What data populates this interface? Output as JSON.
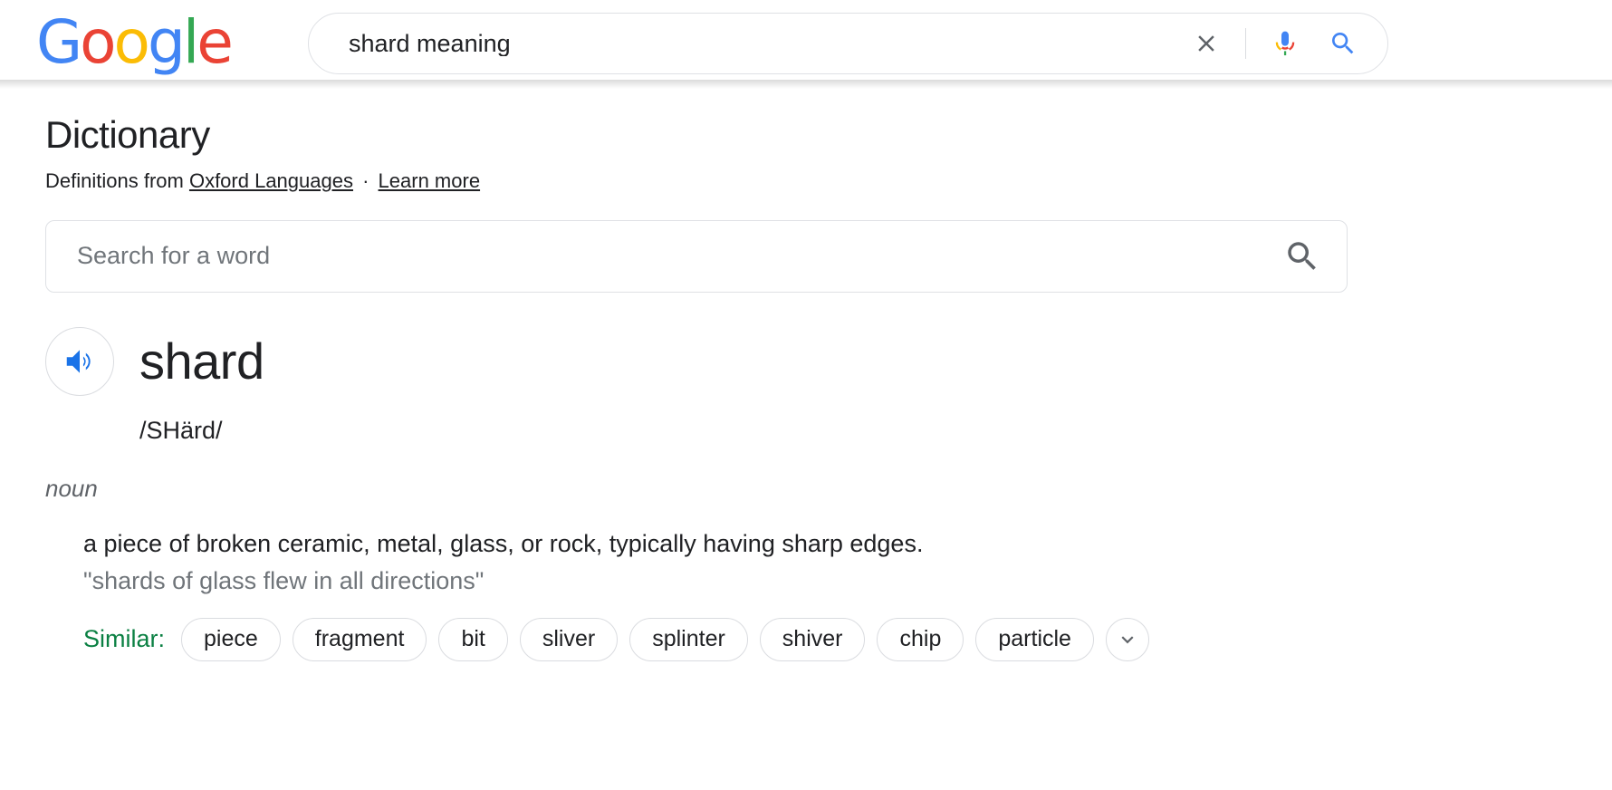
{
  "header": {
    "logo": {
      "letters": [
        {
          "char": "G",
          "color": "#4285F4"
        },
        {
          "char": "o",
          "color": "#EA4335"
        },
        {
          "char": "o",
          "color": "#FBBC05"
        },
        {
          "char": "g",
          "color": "#4285F4"
        },
        {
          "char": "l",
          "color": "#34A853"
        },
        {
          "char": "e",
          "color": "#EA4335"
        }
      ],
      "name": "Google"
    },
    "search": {
      "value": "shard meaning",
      "clear_icon": "close-icon",
      "mic_icon": "microphone-icon",
      "search_icon": "search-icon"
    }
  },
  "main": {
    "title": "Dictionary",
    "attribution": {
      "prefix": "Definitions from ",
      "source_link": "Oxford Languages",
      "separator": " · ",
      "learn_more_link": "Learn more"
    },
    "word_search": {
      "placeholder": "Search for a word",
      "value": "",
      "icon": "search-icon"
    },
    "entry": {
      "audio_icon": "speaker-icon",
      "headword": "shard",
      "phonetic": "/SHärd/",
      "part_of_speech": "noun",
      "definition": "a piece of broken ceramic, metal, glass, or rock, typically having sharp edges.",
      "example": "\"shards of glass flew in all directions\"",
      "similar_label": "Similar:",
      "synonyms": [
        "piece",
        "fragment",
        "bit",
        "sliver",
        "splinter",
        "shiver",
        "chip",
        "particle"
      ],
      "expand_icon": "chevron-down-icon"
    }
  },
  "colors": {
    "google_blue": "#4285F4",
    "google_red": "#EA4335",
    "google_yellow": "#FBBC05",
    "google_green": "#34A853",
    "similar_green": "#0b8043",
    "text_primary": "#202124",
    "text_secondary": "#70757a",
    "border": "#dfe1e5"
  }
}
